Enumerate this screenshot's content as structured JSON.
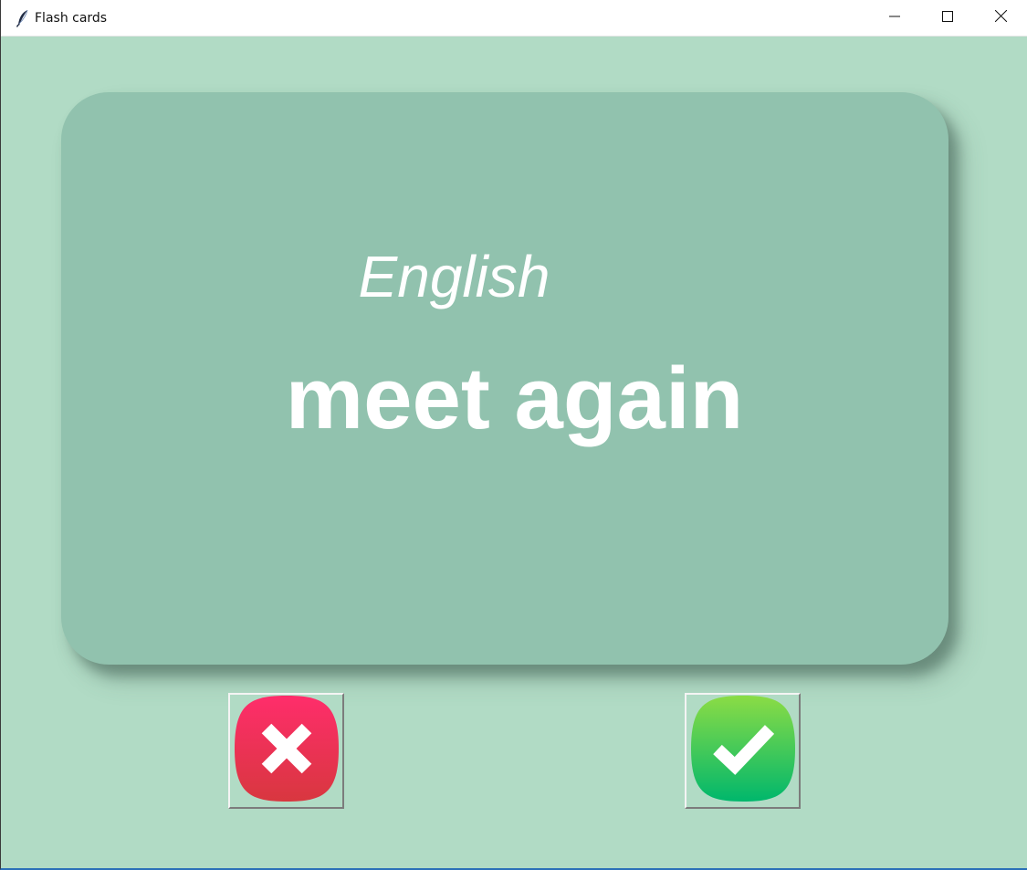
{
  "window": {
    "title": "Flash cards",
    "icon": "feather-icon",
    "controls": [
      "minimize-icon",
      "maximize-icon",
      "close-icon"
    ]
  },
  "card": {
    "language": "English",
    "word": "meet again"
  },
  "buttons": {
    "wrong": {
      "icon": "cross-icon",
      "color_top": "#ff2d6b",
      "color_bottom": "#d8373f"
    },
    "right": {
      "icon": "checkmark-icon",
      "color_top": "#8bdc45",
      "color_bottom": "#00b76c"
    }
  },
  "colors": {
    "background": "#b1dbc5",
    "card": "#91c2ae",
    "text": "#ffffff"
  }
}
